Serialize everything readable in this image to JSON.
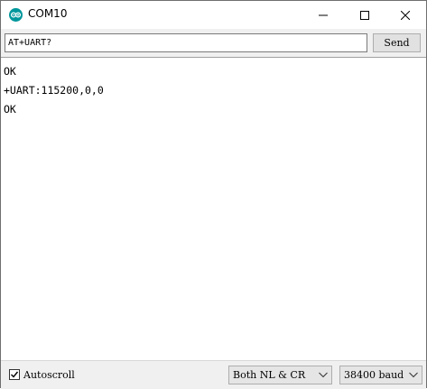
{
  "window": {
    "title": "COM10",
    "icon": "arduino-logo-icon",
    "controls": [
      "minimize-icon",
      "maximize-icon",
      "close-icon"
    ],
    "accent_color": "#00979c"
  },
  "send_bar": {
    "input_value": "AT+UART?",
    "send_label": "Send"
  },
  "output": {
    "lines": [
      "OK",
      "+UART:115200,0,0",
      "OK"
    ]
  },
  "footer": {
    "autoscroll_label": "Autoscroll",
    "autoscroll_checked": true,
    "line_ending": "Both NL & CR",
    "baud_rate": "38400 baud"
  }
}
